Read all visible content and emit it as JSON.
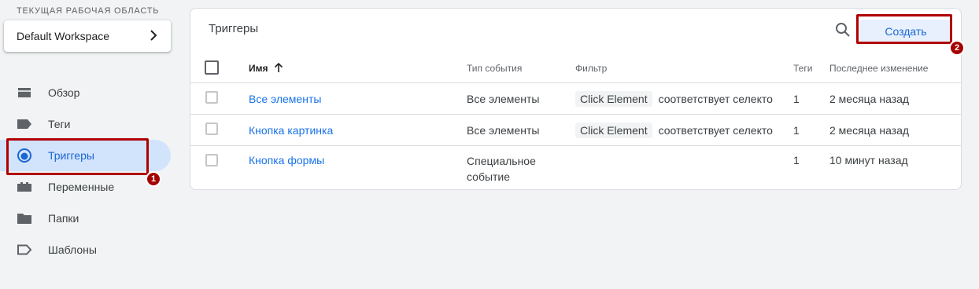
{
  "workspace": {
    "caption": "ТЕКУЩАЯ РАБОЧАЯ ОБЛАСТЬ",
    "name": "Default Workspace"
  },
  "sidebar": {
    "items": [
      {
        "label": "Обзор",
        "icon": "overview-icon"
      },
      {
        "label": "Теги",
        "icon": "tag-icon"
      },
      {
        "label": "Триггеры",
        "icon": "trigger-icon",
        "active": true
      },
      {
        "label": "Переменные",
        "icon": "variable-icon"
      },
      {
        "label": "Папки",
        "icon": "folder-icon"
      },
      {
        "label": "Шаблоны",
        "icon": "template-icon"
      }
    ]
  },
  "panel": {
    "title": "Триггеры",
    "create_label": "Создать"
  },
  "table": {
    "headers": {
      "name": "Имя",
      "event_type": "Тип события",
      "filter": "Фильтр",
      "tags": "Теги",
      "modified": "Последнее изменение"
    },
    "rows": [
      {
        "name": "Все элементы",
        "event_type": "Все элементы",
        "filter_chip": "Click Element",
        "filter_text": "соответствует селекто",
        "tags": "1",
        "modified": "2 месяца назад"
      },
      {
        "name": "Кнопка картинка",
        "event_type": "Все элементы",
        "filter_chip": "Click Element",
        "filter_text": "соответствует селекто",
        "tags": "1",
        "modified": "2 месяца назад"
      },
      {
        "name": "Кнопка формы",
        "event_type": "Специальное событие",
        "filter_chip": "",
        "filter_text": "",
        "tags": "1",
        "modified": "10 минут назад"
      }
    ]
  },
  "annotations": {
    "badge1": "1",
    "badge2": "2",
    "highlight_color": "#b00000"
  },
  "colors": {
    "accent": "#1a73e8",
    "active_bg": "#d2e3fc",
    "create_bg": "#e8f0fe"
  }
}
